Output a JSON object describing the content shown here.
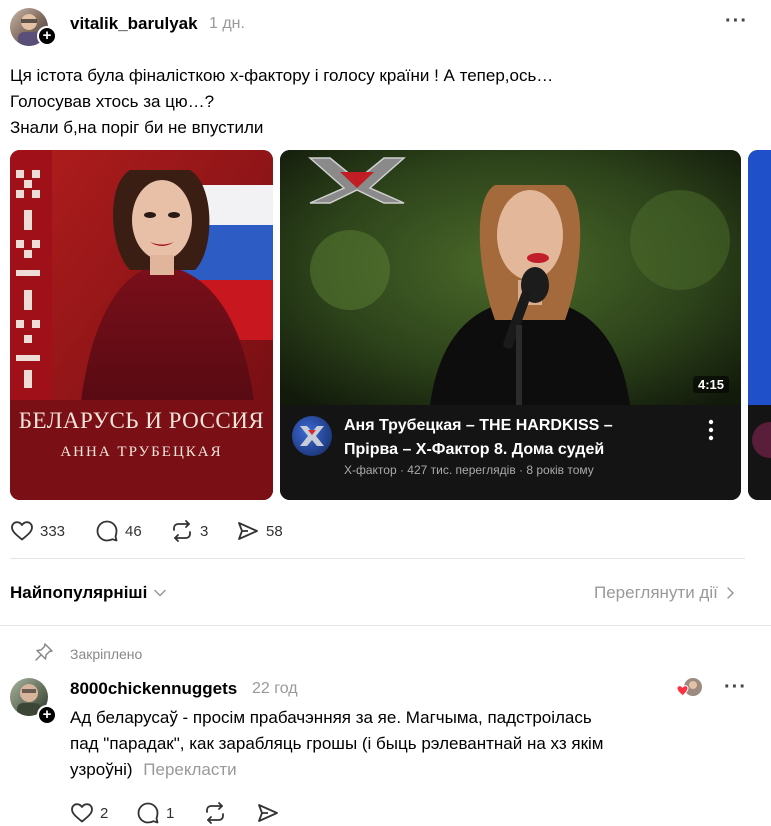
{
  "post": {
    "username": "vitalik_barulyak",
    "time": "1 дн.",
    "lines": [
      "Ця істота була фіналісткою х-фактору і голосу країни ! А тепер,ось…",
      "Голосував хтось за цю…?",
      "Знали б,на поріг би не впустили"
    ],
    "album": {
      "title": "БЕЛАРУСЬ И РОССИЯ",
      "artist": "АННА ТРУБЕЦКАЯ"
    },
    "video": {
      "duration": "4:15",
      "title_line1": "Аня Трубецкая – THE HARDKISS –",
      "title_line2": "Прірва – Х-Фактор 8. Дома судей",
      "meta": "Х-фактор · 427 тис. переглядів · 8 років тому"
    },
    "actions": {
      "likes": "333",
      "comments": "46",
      "reposts": "3",
      "shares": "58"
    }
  },
  "sort": {
    "label": "Найпопулярніші",
    "activity": "Переглянути дії"
  },
  "comment": {
    "pinned_label": "Закріплено",
    "username": "8000chickennuggets",
    "time": "22 год",
    "lines": [
      "Ад беларусаў - просім прабачэнняя за яе. Магчыма, падстроілась",
      "пад \"парадак\", как зарабляць грошы (і быць рэлевантнай на хз якім",
      "узроўні)"
    ],
    "translate": "Перекласти",
    "actions": {
      "likes": "2",
      "comments": "1"
    }
  },
  "colors": {
    "text": "#000000",
    "muted": "#999999",
    "divider": "#e4e4e4",
    "like_heart": "#ff3040"
  }
}
